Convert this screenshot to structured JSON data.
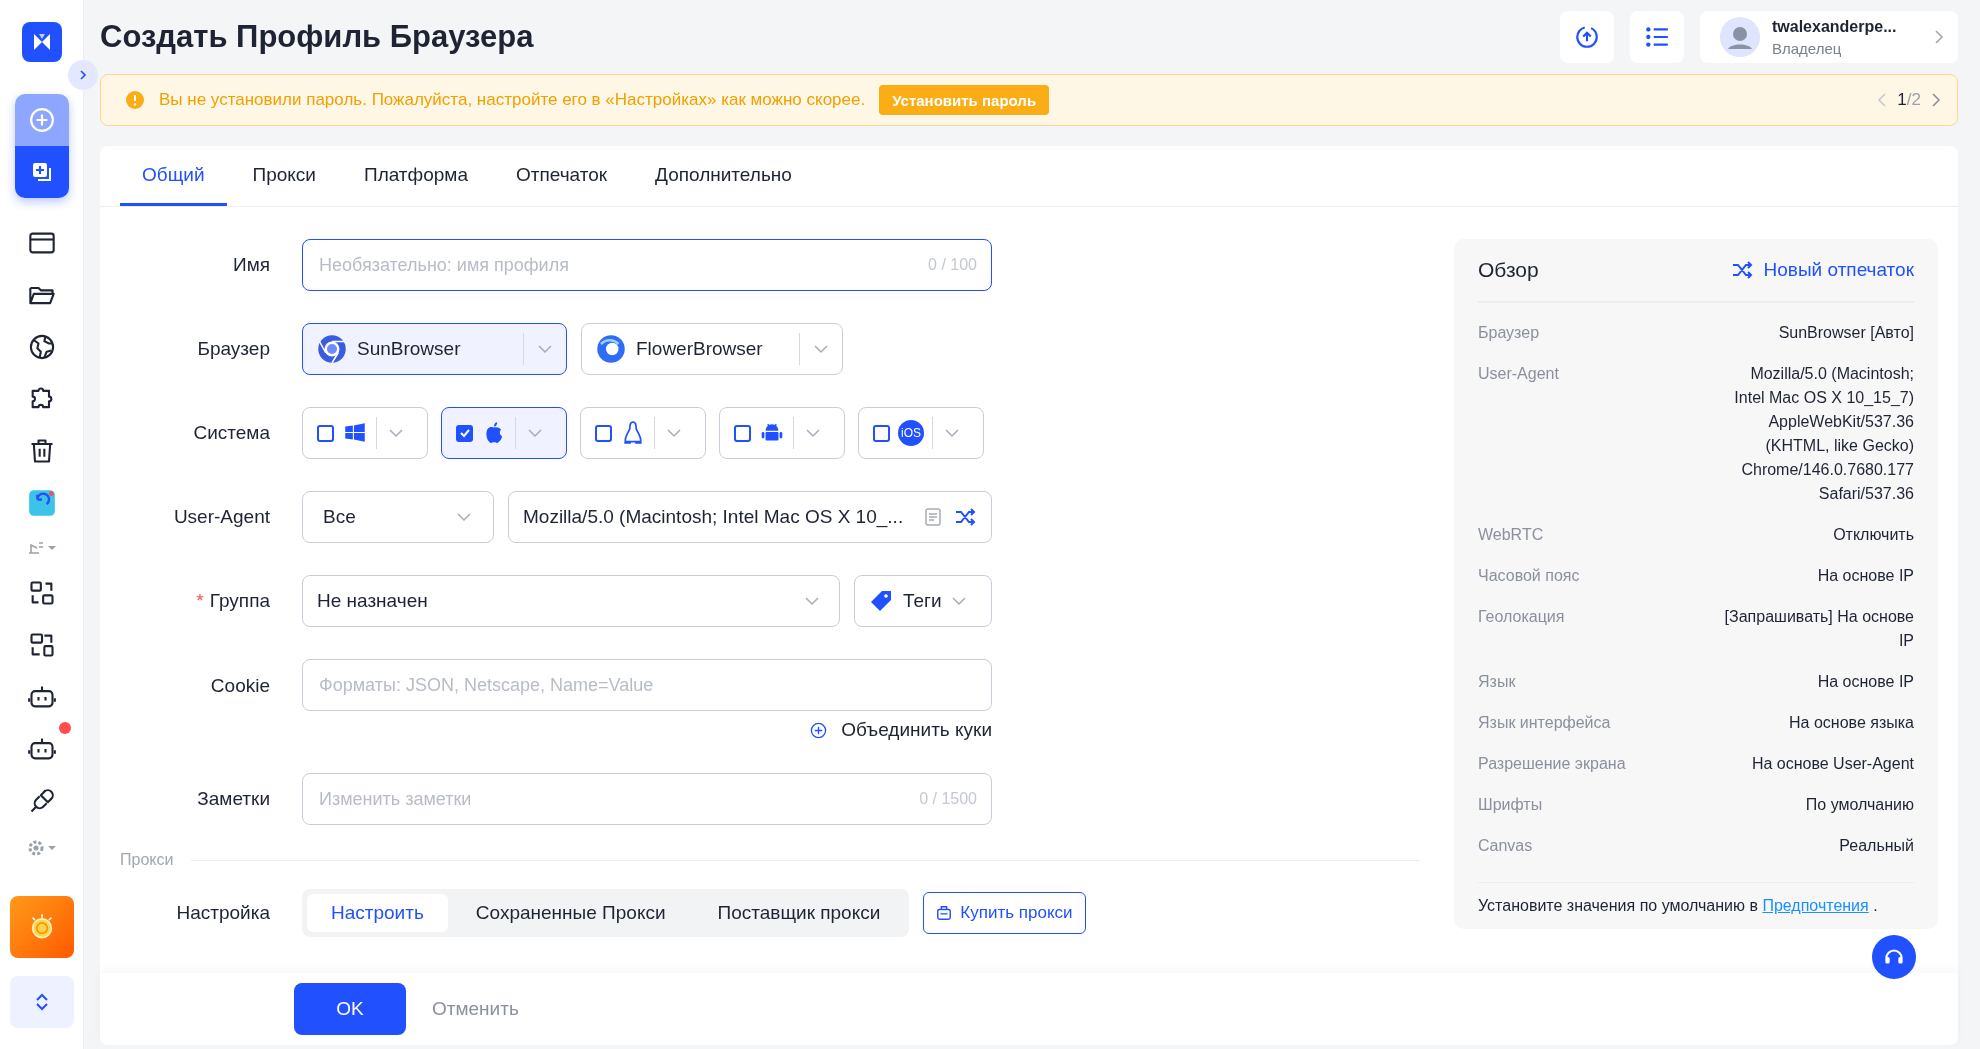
{
  "sidebar": {
    "items": [
      {
        "kind": "window",
        "badge": false
      },
      {
        "kind": "folder",
        "badge": false
      },
      {
        "kind": "globe",
        "badge": false
      },
      {
        "kind": "puzzle",
        "badge": false
      },
      {
        "kind": "trash",
        "badge": false
      },
      {
        "kind": "sync",
        "badge": false
      },
      {
        "kind": "divider"
      },
      {
        "kind": "flow",
        "badge": false
      },
      {
        "kind": "devices",
        "badge": false
      },
      {
        "kind": "robot",
        "badge": false
      },
      {
        "kind": "robot",
        "badge": true
      },
      {
        "kind": "plug",
        "badge": false
      },
      {
        "kind": "gear"
      }
    ]
  },
  "header": {
    "title": "Создать Профиль Браузера",
    "user": {
      "name": "twalexanderpe...",
      "role": "Владелец"
    }
  },
  "banner": {
    "text": "Вы не установили пароль. Пожалуйста, настройте его в «Настройках» как можно скорее.",
    "button": "Установить пароль",
    "pager": "**1**/2"
  },
  "tabs": [
    {
      "label": "Общий",
      "selected": true
    },
    {
      "label": "Прокси",
      "selected": false
    },
    {
      "label": "Платформа",
      "selected": false
    },
    {
      "label": "Отпечаток",
      "selected": false
    },
    {
      "label": "Дополнительно",
      "selected": false
    }
  ],
  "form": {
    "name": {
      "label": "Имя",
      "placeholder": "Необязательно: имя профиля",
      "counter": "0 / 100"
    },
    "browser": {
      "label": "Браузер",
      "options": [
        {
          "label": "SunBrowser",
          "kind": "sun",
          "selected": true
        },
        {
          "label": "FlowerBrowser",
          "kind": "flower",
          "selected": false
        }
      ]
    },
    "system": {
      "label": "Система",
      "options": [
        {
          "kind": "windows",
          "checked": false,
          "selected": false
        },
        {
          "kind": "apple",
          "checked": true,
          "selected": true
        },
        {
          "kind": "linux",
          "checked": false,
          "selected": false
        },
        {
          "kind": "android",
          "checked": false,
          "selected": false
        },
        {
          "kind": "ios",
          "checked": false,
          "selected": false,
          "text": "iOS"
        }
      ]
    },
    "user_agent": {
      "label": "User-Agent",
      "select": "Все",
      "value": "Mozilla/5.0 (Macintosh; Intel Mac OS X 10_..."
    },
    "group": {
      "label": "Группа",
      "required_mark": "*",
      "value": "Не назначен",
      "tags": "Теги"
    },
    "cookie": {
      "label": "Cookie",
      "placeholder": "Форматы: JSON, Netscape, Name=Value",
      "merge": "Объединить куки"
    },
    "notes": {
      "label": "Заметки",
      "placeholder": "Изменить заметки",
      "counter": "0 / 1500"
    },
    "section": "Прокси",
    "proxy": {
      "label": "Настройка",
      "segments": [
        {
          "label": "Настроить",
          "selected": true
        },
        {
          "label": "Сохраненные Прокси",
          "selected": false
        },
        {
          "label": "Поставщик прокси",
          "selected": false
        }
      ],
      "buy": "Купить прокси"
    }
  },
  "overview": {
    "title": "Обзор",
    "action": "Новый отпечаток",
    "rows": [
      {
        "label": "Браузер",
        "value": "SunBrowser [Авто]"
      },
      {
        "label": "User-Agent",
        "value": "Mozilla/5.0 (Macintosh; Intel Mac OS X 10_15_7) AppleWebKit/537.36 (KHTML, like Gecko) Chrome/146.0.7680.177 Safari/537.36"
      },
      {
        "label": "WebRTC",
        "value": "Отключить"
      },
      {
        "label": "Часовой пояс",
        "value": "На основе IP"
      },
      {
        "label": "Геолокация",
        "value": "[Запрашивать] На основе IP"
      },
      {
        "label": "Язык",
        "value": "На основе IP"
      },
      {
        "label": "Язык интерфейса",
        "value": "На основе языка"
      },
      {
        "label": "Разрешение экрана",
        "value": "На основе User-Agent"
      },
      {
        "label": "Шрифты",
        "value": "По умолчанию"
      },
      {
        "label": "Canvas",
        "value": "Реальный"
      }
    ],
    "note": "Установите значения по умолчанию в",
    "link": "Предпочтения",
    "note_end": "."
  },
  "footer": {
    "ok": "OK",
    "cancel": "Отменить"
  }
}
